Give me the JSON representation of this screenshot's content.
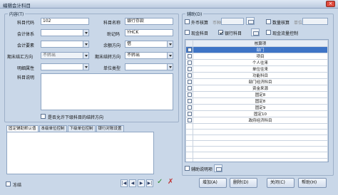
{
  "window": {
    "title": "编辑会计科目",
    "close": "×"
  },
  "content_group": {
    "legend": "内容(T)",
    "code_label": "科目代码",
    "code_value": "102",
    "name_label": "科目名称",
    "name_value": "银行存款",
    "system_label": "会计体系",
    "mnemonic_label": "助记码",
    "mnemonic_value": "YHCK",
    "element_label": "会计要素",
    "balance_dir_label": "余额方向",
    "balance_dir_value": "借",
    "period_close_label": "期末结汇方向",
    "period_close_value": "不转出",
    "year_close_label": "期末结转方向",
    "year_close_value": "不转出",
    "detail_attr_label": "明细属性",
    "unit_type_label": "单位类型",
    "description_label": "科目说明",
    "allow_lower_label": "是否允许下级科目的结转方向"
  },
  "tabs": [
    "固定辅助默认值",
    "本级单位控制",
    "下级单位控制",
    "银行对账设置"
  ],
  "aux_group": {
    "legend": "辅助(D)",
    "foreign_label": "外币核算",
    "currency_label": "币种",
    "quantity_label": "数量核算",
    "unit_label": "单位",
    "cash_label": "现金科目",
    "bank_label": "银行科目",
    "cashflow_label": "现金流量控制",
    "grid_header": "核算项",
    "grid_rows": [
      "部门",
      "项目",
      "个人往来",
      "单位往来",
      "功能科目",
      "部门经济科目",
      "资金来源",
      "固定8",
      "固定8",
      "固定9",
      "固定10",
      "政府经济科目"
    ],
    "aux_desc_label": "辅助说明项"
  },
  "footer": {
    "disabled_label": "冻结",
    "add_btn": "增加",
    "add_key": "(A)",
    "delete_btn": "删除",
    "delete_key": "(D)",
    "close_btn": "关闭",
    "close_key": "(C)",
    "help_btn": "帮助",
    "help_key": "(H)"
  },
  "icons": {
    "ok": "check-icon",
    "cancel": "cross-icon"
  },
  "colors": {
    "selection": "#3e74c6",
    "ok": "#2a8a2a",
    "cancel": "#c03030"
  }
}
